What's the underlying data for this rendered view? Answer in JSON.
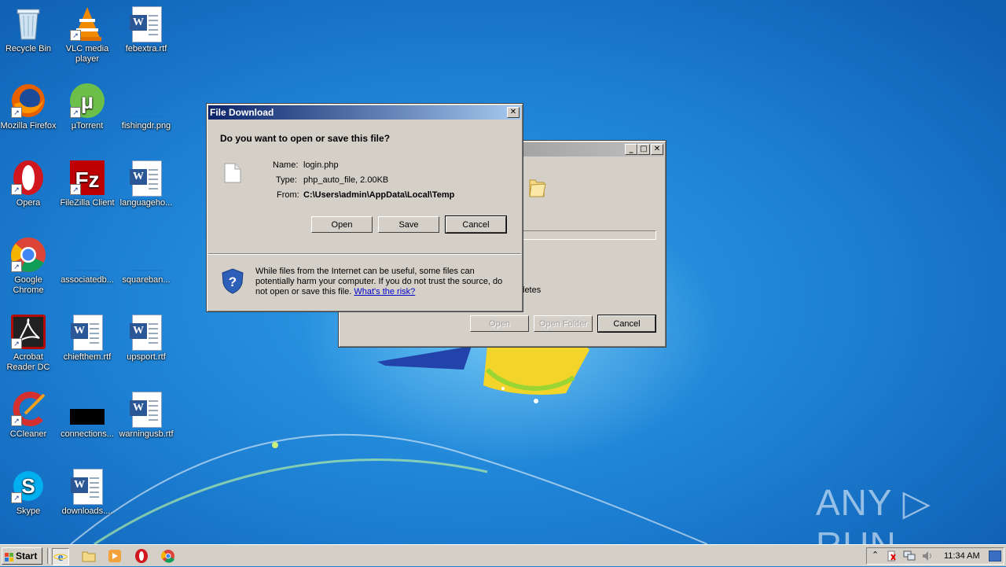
{
  "desktop_icons": [
    {
      "label": "Recycle Bin",
      "icon": "recycle-bin-icon"
    },
    {
      "label": "VLC media player",
      "icon": "vlc-icon"
    },
    {
      "label": "febextra.rtf",
      "icon": "word-document-icon"
    },
    {
      "label": "Mozilla Firefox",
      "icon": "firefox-icon"
    },
    {
      "label": "µTorrent",
      "icon": "utorrent-icon"
    },
    {
      "label": "fishingdr.png",
      "icon": "image-file-icon"
    },
    {
      "label": "Opera",
      "icon": "opera-icon"
    },
    {
      "label": "FileZilla Client",
      "icon": "filezilla-icon"
    },
    {
      "label": "languageho...",
      "icon": "word-document-icon"
    },
    {
      "label": "Google Chrome",
      "icon": "chrome-icon"
    },
    {
      "label": "associatedb...",
      "icon": "file-icon"
    },
    {
      "label": "squareban...",
      "icon": "file-icon"
    },
    {
      "label": "Acrobat Reader DC",
      "icon": "acrobat-icon"
    },
    {
      "label": "chiefthem.rtf",
      "icon": "word-document-icon"
    },
    {
      "label": "upsport.rtf",
      "icon": "word-document-icon"
    },
    {
      "label": "CCleaner",
      "icon": "ccleaner-icon"
    },
    {
      "label": "connections...",
      "icon": "black-file-icon"
    },
    {
      "label": "warningusb.rtf",
      "icon": "word-document-icon"
    },
    {
      "label": "Skype",
      "icon": "skype-icon"
    },
    {
      "label": "downloads....",
      "icon": "word-document-icon"
    }
  ],
  "dialog": {
    "title": "File Download",
    "close": "✕",
    "question": "Do you want to open or save this file?",
    "name_label": "Name:",
    "name_value": "login.php",
    "type_label": "Type:",
    "type_value": "php_auto_file, 2.00KB",
    "from_label": "From:",
    "from_value": "C:\\Users\\admin\\AppData\\Local\\Temp",
    "open_button": "Open",
    "save_button": "Save",
    "cancel_button": "Cancel",
    "warning_text": "While files from the Internet can be useful, some files can potentially harm your computer. If you do not trust the source, do not open or save this file.",
    "risk_link": "What's the risk?"
  },
  "background_window": {
    "minimize": "_",
    "maximize": "□",
    "close": "✕",
    "partial_text": "letes",
    "open_button": "Open",
    "open_folder_button": "Open Folder",
    "cancel_button": "Cancel"
  },
  "taskbar": {
    "start_label": "Start",
    "clock": "11:34 AM",
    "quicklaunch": [
      "ie-icon",
      "explorer-icon",
      "media-player-icon",
      "opera-icon",
      "chrome-icon"
    ]
  },
  "watermark": "ANY ▷ RUN"
}
